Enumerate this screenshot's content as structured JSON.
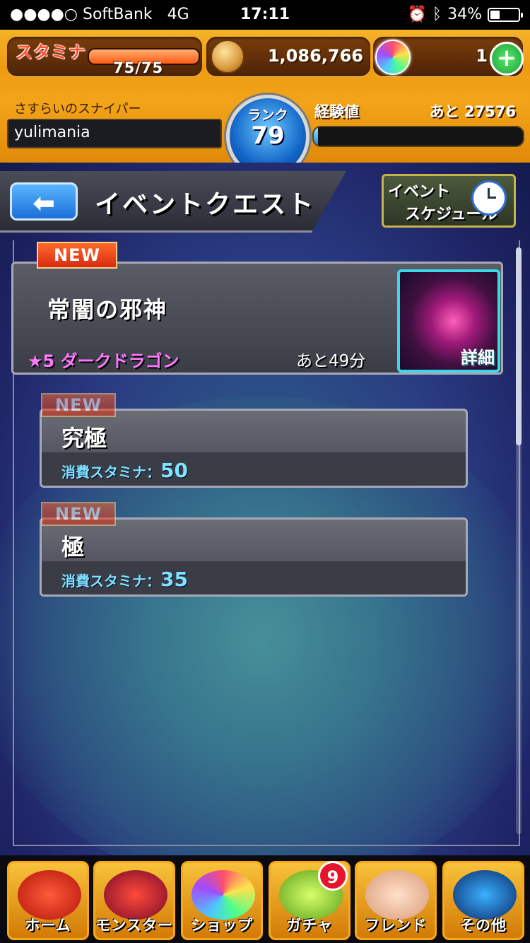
{
  "status_bar": {
    "carrier": "●●●●○ SoftBank",
    "network": "4G",
    "time": "17:11",
    "battery_text": "34%",
    "battery_fraction": 0.34
  },
  "header": {
    "stamina_label": "スタミナ",
    "stamina_value": "75/75",
    "stamina_fraction": 1.0,
    "coins": "1,086,766",
    "orbs": "1",
    "player_title": "さすらいのスナイパー",
    "player_name": "yulimania",
    "rank_label": "ランク",
    "rank_value": "79",
    "exp_label": "経験値",
    "exp_remaining": "あと 27576",
    "exp_fraction": 0.02,
    "icons": [
      "coin-icon",
      "orb-icon",
      "plus-icon",
      "back-arrow-icon",
      "clock-icon"
    ]
  },
  "page": {
    "title": "イベントクエスト",
    "back_symbol": "⬅",
    "schedule_line1": "イベント",
    "schedule_line2": "スケジュール"
  },
  "quest": {
    "new_tag": "NEW",
    "title": "常闇の邪神",
    "boss": "★5 ダークドラゴン",
    "time_left": "あと49分",
    "detail_label": "詳細"
  },
  "difficulties": [
    {
      "new_tag": "NEW",
      "name": "究極",
      "cost_label": "消費スタミナ：",
      "cost": "50"
    },
    {
      "new_tag": "NEW",
      "name": "極",
      "cost_label": "消費スタミナ：",
      "cost": "35"
    }
  ],
  "nav": {
    "items": [
      {
        "label": "ホーム"
      },
      {
        "label": "モンスター"
      },
      {
        "label": "ショップ"
      },
      {
        "label": "ガチャ"
      },
      {
        "label": "フレンド"
      },
      {
        "label": "その他"
      }
    ],
    "gacha_badge": "9"
  },
  "colors": {
    "header_orange": "#ef9b12",
    "accent_blue": "#1a6fd8",
    "new_red": "#d82a10",
    "boss_pink": "#ff78ff",
    "cost_cyan": "#7fe3ff"
  }
}
